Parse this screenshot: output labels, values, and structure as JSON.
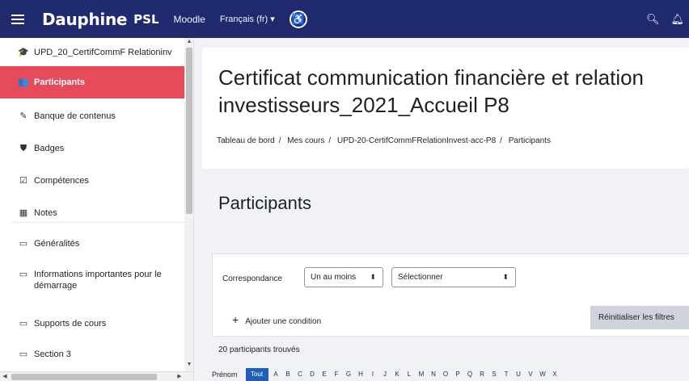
{
  "navbar": {
    "brand": "Dauphine",
    "brand_suffix": "PSL",
    "moodle_link": "Moodle",
    "language": "Français (fr) ▾"
  },
  "sidebar": {
    "items": [
      {
        "label": "UPD_20_CertifCommF Relationinv",
        "icon": "graduation-cap-icon",
        "glyph": "🎓"
      },
      {
        "label": "Participants",
        "icon": "users-icon",
        "glyph": "👥",
        "active": true
      },
      {
        "label": "Banque de contenus",
        "icon": "pencil-icon",
        "glyph": "✎"
      },
      {
        "label": "Badges",
        "icon": "shield-icon",
        "glyph": "⛊"
      },
      {
        "label": "Compétences",
        "icon": "check-square-icon",
        "glyph": "☑"
      },
      {
        "label": "Notes",
        "icon": "table-icon",
        "glyph": "▦"
      },
      {
        "label": "Généralités",
        "icon": "folder-icon",
        "glyph": "▭"
      },
      {
        "label": "Informations importantes pour le démarrage",
        "icon": "folder-icon",
        "glyph": "▭"
      },
      {
        "label": "Supports de cours",
        "icon": "folder-icon",
        "glyph": "▭"
      },
      {
        "label": "Section 3",
        "icon": "folder-icon",
        "glyph": "▭"
      }
    ]
  },
  "header": {
    "title": "Certificat communication financière et relation\ninvestisseurs_2021_Accueil P8",
    "breadcrumb": [
      "Tableau de bord",
      "Mes cours",
      "UPD-20-CertifCommFRelationInvest-acc-P8",
      "Participants"
    ]
  },
  "main": {
    "section_title": "Participants",
    "filter": {
      "label": "Correspondance",
      "match_value": "Un au moins",
      "type_value": "Sélectionner",
      "add_condition": "Ajouter une condition",
      "reset": "Réinitialiser les filtres"
    },
    "found": "20 participants trouvés",
    "initials": {
      "label": "Prénom",
      "letters": [
        "Tout",
        "A",
        "B",
        "C",
        "D",
        "E",
        "F",
        "G",
        "H",
        "I",
        "J",
        "K",
        "L",
        "M",
        "N",
        "O",
        "P",
        "Q",
        "R",
        "S",
        "T",
        "U",
        "V",
        "W",
        "X"
      ]
    }
  },
  "colors": {
    "navbar": "#1f2b6e",
    "active_item": "#e74b5a",
    "letter_active": "#1f5fb8"
  }
}
